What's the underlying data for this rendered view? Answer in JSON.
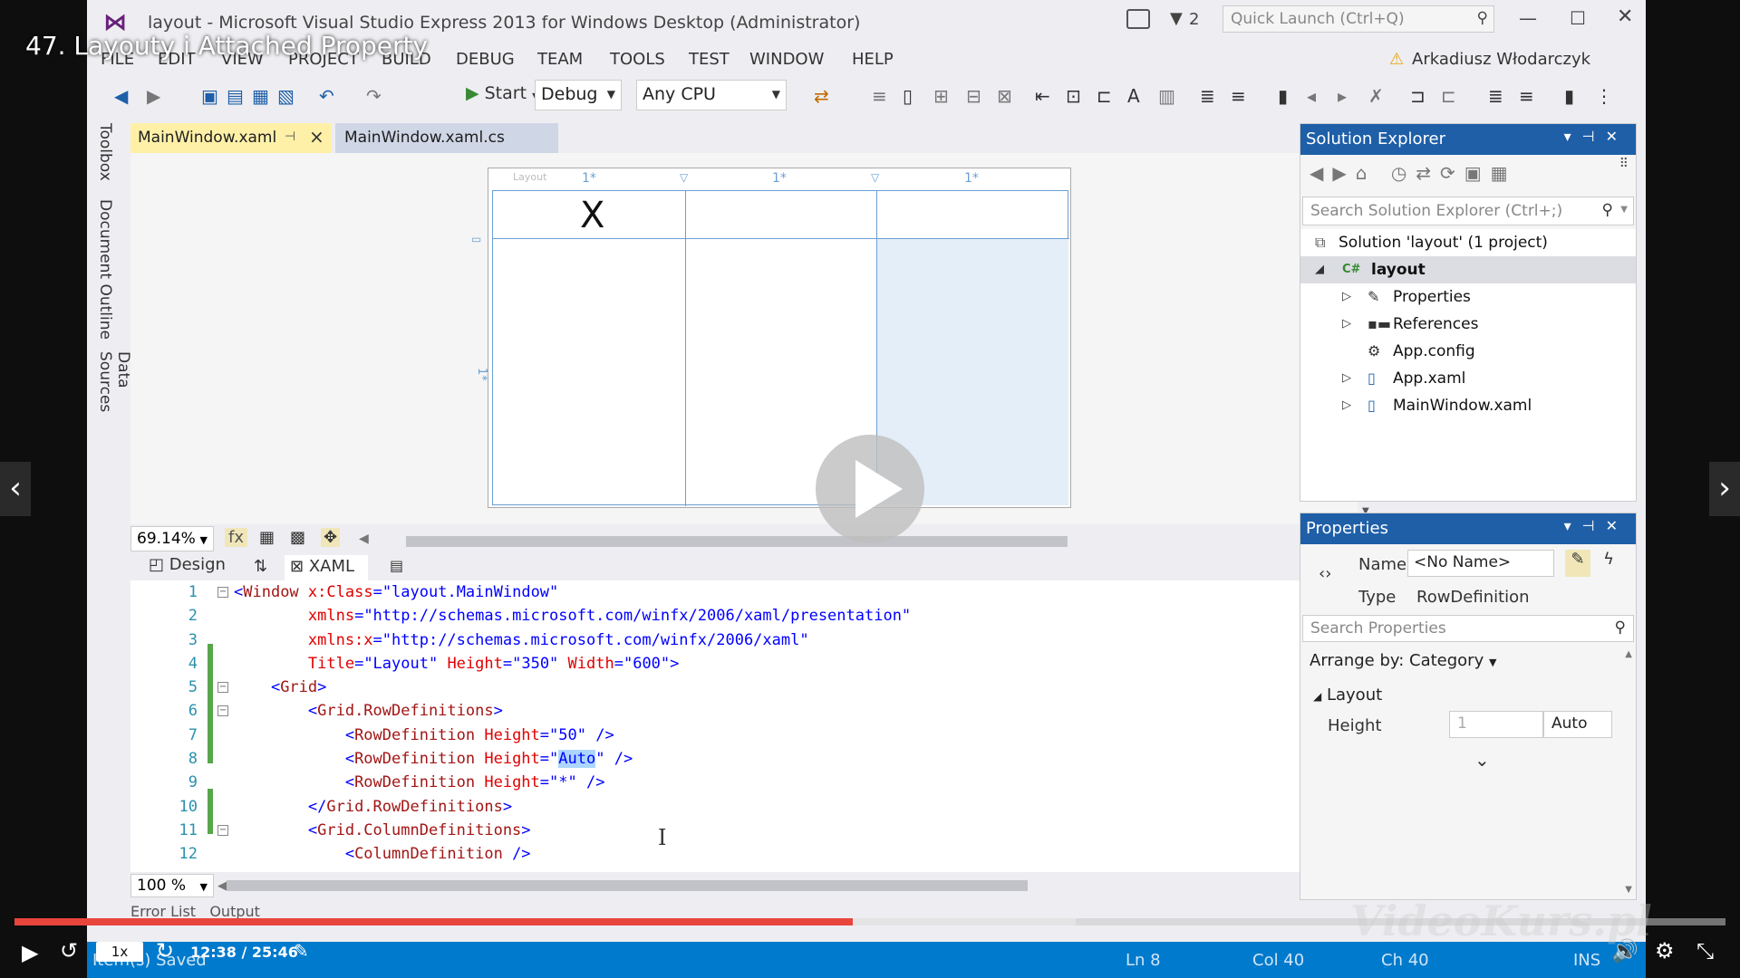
{
  "player": {
    "video_title": "47. Layouty i Attached Property",
    "speed": "1x",
    "time": "12:38 / 25:46",
    "progress_fraction": 0.49,
    "buffered_fraction": 0.62,
    "watermark": "VideoKurs.pl",
    "prev_arrow": "‹",
    "next_arrow": "›"
  },
  "window": {
    "title": "layout - Microsoft Visual Studio Express 2013 for Windows Desktop (Administrator)",
    "notification_count": "2",
    "quick_launch_placeholder": "Quick Launch (Ctrl+Q)",
    "user_name": "Arkadiusz Włodarczyk",
    "menu": [
      "FILE",
      "EDIT",
      "VIEW",
      "PROJECT",
      "BUILD",
      "DEBUG",
      "TEAM",
      "TOOLS",
      "TEST",
      "WINDOW",
      "HELP"
    ]
  },
  "toolbar": {
    "start_label": "Start",
    "configuration": "Debug",
    "platform": "Any CPU"
  },
  "left_rail": [
    "Toolbox",
    "Document Outline",
    "Data Sources"
  ],
  "tabs": {
    "active": "MainWindow.xaml",
    "inactive": "MainWindow.xaml.cs"
  },
  "designer": {
    "layout_label": "Layout",
    "columns": [
      "1*",
      "1*",
      "1*"
    ],
    "row_label": "1*",
    "cell_text": "X",
    "zoom": "69.14%",
    "fx": "fx"
  },
  "split": {
    "design_tab": "Design",
    "xaml_tab": "XAML"
  },
  "editor": {
    "line_numbers": [
      "1",
      "2",
      "3",
      "4",
      "5",
      "6",
      "7",
      "8",
      "9",
      "10",
      "11",
      "12"
    ],
    "zoom": "100 %",
    "lines": [
      {
        "parts": [
          [
            "p",
            "<"
          ],
          [
            "t",
            "Window"
          ],
          [
            "a",
            " x:Class"
          ],
          [
            "p",
            "="
          ],
          [
            "v",
            "\"layout.MainWindow\""
          ]
        ]
      },
      {
        "parts": [
          [
            "a",
            "        xmlns"
          ],
          [
            "p",
            "="
          ],
          [
            "v",
            "\"http://schemas.microsoft.com/winfx/2006/xaml/presentation\""
          ]
        ]
      },
      {
        "parts": [
          [
            "a",
            "        xmlns:x"
          ],
          [
            "p",
            "="
          ],
          [
            "v",
            "\"http://schemas.microsoft.com/winfx/2006/xaml\""
          ]
        ]
      },
      {
        "parts": [
          [
            "a",
            "        Title"
          ],
          [
            "p",
            "="
          ],
          [
            "v",
            "\"Layout\""
          ],
          [
            "a",
            " Height"
          ],
          [
            "p",
            "="
          ],
          [
            "v",
            "\"350\""
          ],
          [
            "a",
            " Width"
          ],
          [
            "p",
            "="
          ],
          [
            "v",
            "\"600\""
          ],
          [
            "p",
            ">"
          ]
        ]
      },
      {
        "parts": [
          [
            "p",
            "    <"
          ],
          [
            "t",
            "Grid"
          ],
          [
            "p",
            ">"
          ]
        ]
      },
      {
        "parts": [
          [
            "p",
            "        <"
          ],
          [
            "t",
            "Grid.RowDefinitions"
          ],
          [
            "p",
            ">"
          ]
        ]
      },
      {
        "parts": [
          [
            "p",
            "            <"
          ],
          [
            "t",
            "RowDefinition"
          ],
          [
            "a",
            " Height"
          ],
          [
            "p",
            "="
          ],
          [
            "v",
            "\"50\""
          ],
          [
            "p",
            " />"
          ]
        ]
      },
      {
        "parts": [
          [
            "p",
            "            <"
          ],
          [
            "t",
            "RowDefinition"
          ],
          [
            "a",
            " Height"
          ],
          [
            "p",
            "="
          ],
          [
            "v",
            "\""
          ],
          [
            "sel",
            "Auto"
          ],
          [
            "v",
            "\""
          ],
          [
            "p",
            " />"
          ]
        ]
      },
      {
        "parts": [
          [
            "p",
            "            <"
          ],
          [
            "t",
            "RowDefinition"
          ],
          [
            "a",
            " Height"
          ],
          [
            "p",
            "="
          ],
          [
            "v",
            "\"*\""
          ],
          [
            "p",
            " />"
          ]
        ]
      },
      {
        "parts": [
          [
            "p",
            "        </"
          ],
          [
            "t",
            "Grid.RowDefinitions"
          ],
          [
            "p",
            ">"
          ]
        ]
      },
      {
        "parts": [
          [
            "p",
            "        <"
          ],
          [
            "t",
            "Grid.ColumnDefinitions"
          ],
          [
            "p",
            ">"
          ]
        ]
      },
      {
        "parts": [
          [
            "p",
            "            <"
          ],
          [
            "t",
            "ColumnDefinition"
          ],
          [
            "p",
            " />"
          ]
        ]
      }
    ]
  },
  "bottom_tabs": {
    "error_list": "Error List",
    "output": "Output"
  },
  "solution_explorer": {
    "title": "Solution Explorer",
    "search_placeholder": "Search Solution Explorer (Ctrl+;)",
    "items": [
      {
        "label": "Solution 'layout' (1 project)",
        "icon": "solution-icon"
      },
      {
        "label": "layout",
        "icon": "csharp-project-icon"
      },
      {
        "label": "Properties",
        "icon": "wrench-icon"
      },
      {
        "label": "References",
        "icon": "references-icon"
      },
      {
        "label": "App.config",
        "icon": "config-file-icon"
      },
      {
        "label": "App.xaml",
        "icon": "xaml-file-icon"
      },
      {
        "label": "MainWindow.xaml",
        "icon": "xaml-file-icon"
      }
    ]
  },
  "properties": {
    "title": "Properties",
    "name_label": "Name",
    "name_value": "<No Name>",
    "type_label": "Type",
    "type_value": "RowDefinition",
    "search_placeholder": "Search Properties",
    "arrange_by": "Arrange by: Category",
    "category": "Layout",
    "height_label": "Height",
    "height_value": "1",
    "height_unit": "Auto"
  },
  "status": {
    "left": "Item(s) Saved",
    "ln": "Ln 8",
    "col": "Col 40",
    "ch": "Ch 40",
    "mode": "INS"
  },
  "colors": {
    "accent": "#007acc",
    "progress": "#e8453c",
    "active_tab": "#fff0a8"
  }
}
